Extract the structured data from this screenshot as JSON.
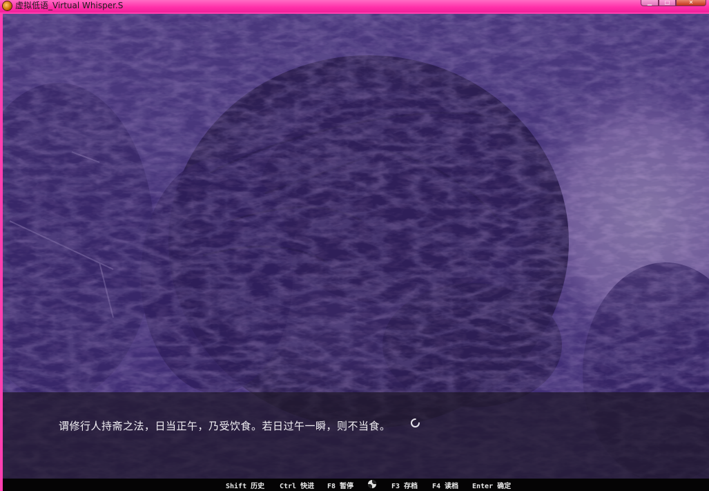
{
  "window": {
    "title": "虚拟低语_Virtual Whisper.S",
    "minimize_glyph": "▁",
    "maximize_glyph": "□",
    "close_glyph": "✕"
  },
  "message": {
    "text": "谓修行人持斋之法，日当正午，乃受饮食。若日过午一瞬，则不当食。"
  },
  "hotkeys": {
    "history": "Shift 历史",
    "skip": "Ctrl 快进",
    "pause": "F8 暂停",
    "auto_icon": "auto-mode-icon",
    "save": "F3 存档",
    "load": "F4 读档",
    "confirm": "Enter 确定"
  },
  "colors": {
    "titlebar": "#ff3fb0",
    "scene_base": "#3b2a6a",
    "sky_light": "#d8c6ee",
    "text": "#f2f0f4"
  }
}
